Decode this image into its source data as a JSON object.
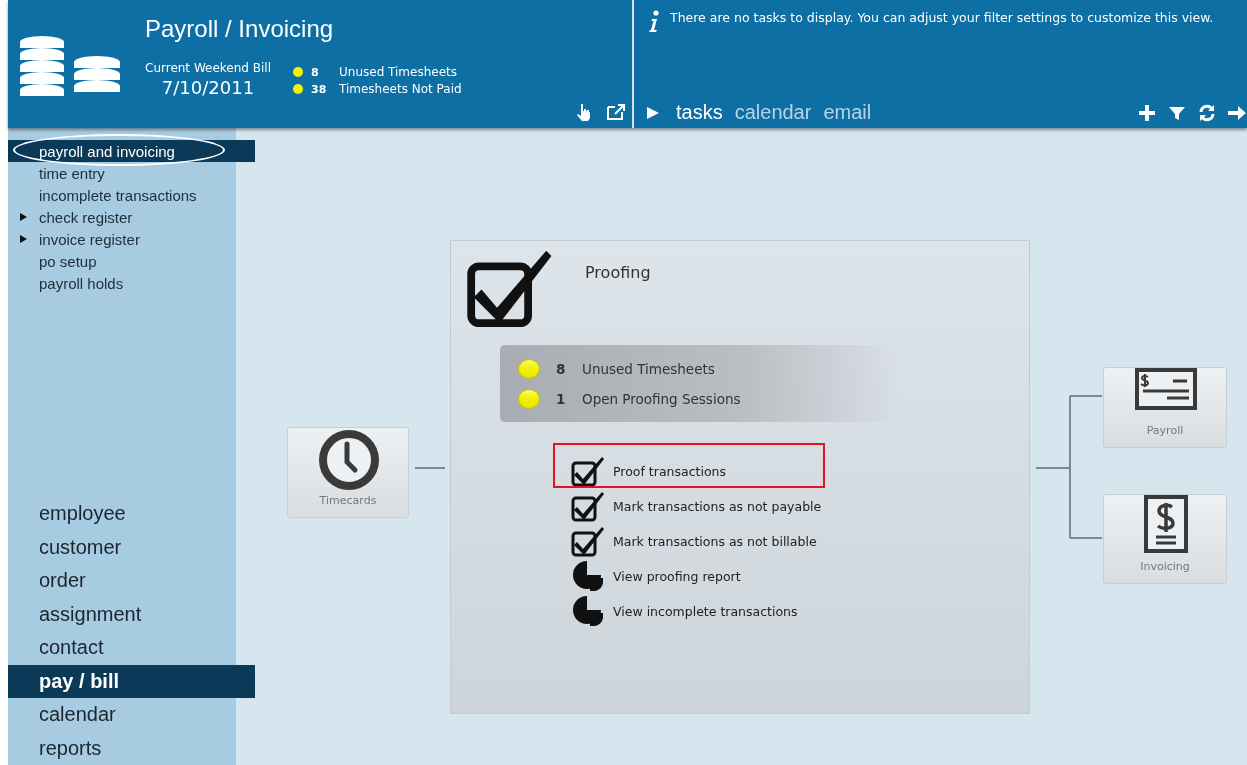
{
  "header": {
    "title": "Payroll / Invoicing",
    "period_label": "Current Weekend Bill",
    "period_date": "7/10/2011",
    "stats": [
      {
        "count": "8",
        "label": "Unused Timesheets"
      },
      {
        "count": "38",
        "label": "Timesheets Not Paid"
      }
    ]
  },
  "tasks_panel": {
    "message": "There are no tasks to display. You can adjust your filter settings to customize this view.",
    "tabs": [
      {
        "label": "tasks",
        "selected": true
      },
      {
        "label": "calendar",
        "selected": false
      },
      {
        "label": "email",
        "selected": false
      }
    ]
  },
  "sidebar": {
    "items": [
      {
        "label": "payroll and invoicing",
        "selected": true,
        "expandable": false,
        "circled": true
      },
      {
        "label": "time entry",
        "selected": false,
        "expandable": false,
        "circled": false
      },
      {
        "label": "incomplete transactions",
        "selected": false,
        "expandable": false,
        "circled": false
      },
      {
        "label": "check register",
        "selected": false,
        "expandable": true,
        "circled": false
      },
      {
        "label": "invoice register",
        "selected": false,
        "expandable": true,
        "circled": false
      },
      {
        "label": "po setup",
        "selected": false,
        "expandable": false,
        "circled": false
      },
      {
        "label": "payroll holds",
        "selected": false,
        "expandable": false,
        "circled": false
      }
    ],
    "modules": [
      {
        "label": "employee",
        "selected": false
      },
      {
        "label": "customer",
        "selected": false
      },
      {
        "label": "order",
        "selected": false
      },
      {
        "label": "assignment",
        "selected": false
      },
      {
        "label": "contact",
        "selected": false
      },
      {
        "label": "pay / bill",
        "selected": true
      },
      {
        "label": "calendar",
        "selected": false
      },
      {
        "label": "reports",
        "selected": false
      }
    ]
  },
  "workflow": {
    "timecards": {
      "label": "Timecards"
    },
    "proofing": {
      "title": "Proofing",
      "statuses": [
        {
          "count": "8",
          "label": "Unused Timesheets"
        },
        {
          "count": "1",
          "label": "Open Proofing Sessions"
        }
      ],
      "actions": [
        {
          "kind": "check",
          "label": "Proof transactions",
          "highlighted": true
        },
        {
          "kind": "check",
          "label": "Mark transactions as not payable",
          "highlighted": false
        },
        {
          "kind": "check",
          "label": "Mark transactions as not billable",
          "highlighted": false
        },
        {
          "kind": "report",
          "label": "View proofing report",
          "highlighted": false
        },
        {
          "kind": "report",
          "label": "View incomplete transactions",
          "highlighted": false
        }
      ]
    },
    "outputs": [
      {
        "kind": "check",
        "label": "Payroll"
      },
      {
        "kind": "invoice",
        "label": "Invoicing"
      }
    ]
  }
}
